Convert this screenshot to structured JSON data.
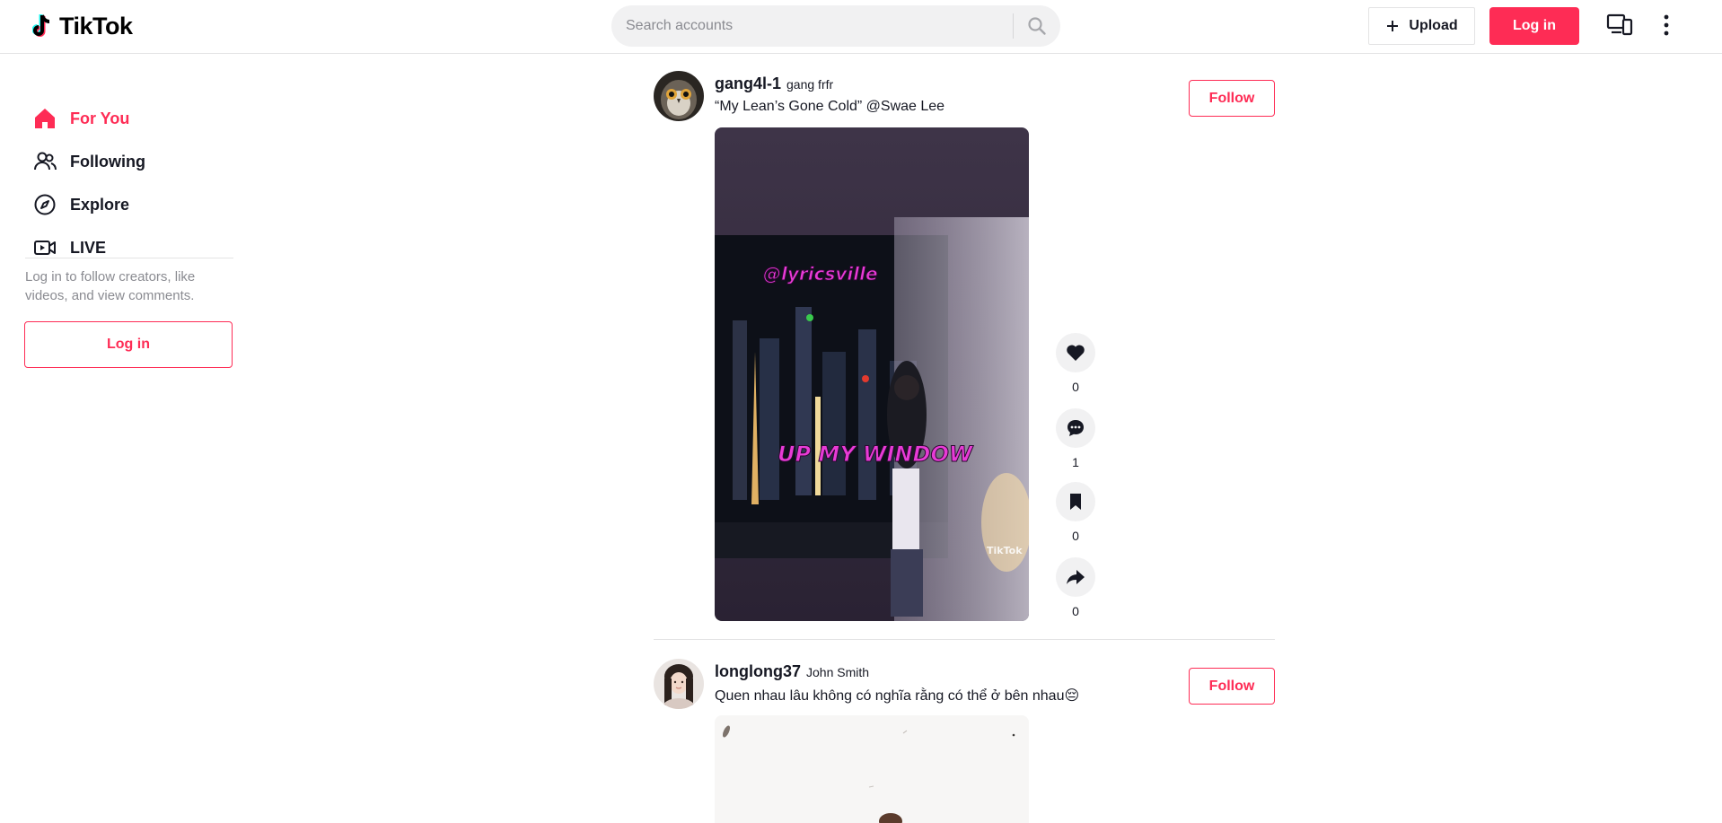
{
  "header": {
    "logo_text": "TikTok",
    "search_placeholder": "Search accounts",
    "upload_label": "Upload",
    "login_label": "Log in"
  },
  "sidebar": {
    "items": [
      {
        "label": "For You",
        "icon": "home-icon",
        "active": true
      },
      {
        "label": "Following",
        "icon": "users-icon",
        "active": false
      },
      {
        "label": "Explore",
        "icon": "compass-icon",
        "active": false
      },
      {
        "label": "LIVE",
        "icon": "live-video-icon",
        "active": false
      }
    ],
    "hint": "Log in to follow creators, like videos, and view comments.",
    "login_label": "Log in"
  },
  "feed": {
    "posts": [
      {
        "username": "gang4l-1",
        "nickname": "gang frfr",
        "caption": "“My Lean’s Gone Cold” @Swae Lee",
        "follow_label": "Follow",
        "video_overlay_top": "@lyricsville",
        "video_overlay_bottom": "UP MY WINDOW",
        "watermark": "TikTok",
        "likes": "0",
        "comments": "1",
        "saves": "0",
        "shares": "0"
      },
      {
        "username": "longlong37",
        "nickname": "John Smith",
        "caption": "Quen nhau lâu không có nghĩa rằng có thể ở bên nhau😔",
        "follow_label": "Follow"
      }
    ]
  },
  "colors": {
    "accent": "#fe2c55",
    "text": "#161823",
    "muted": "#8a8b91",
    "border": "#e3e3e4"
  }
}
